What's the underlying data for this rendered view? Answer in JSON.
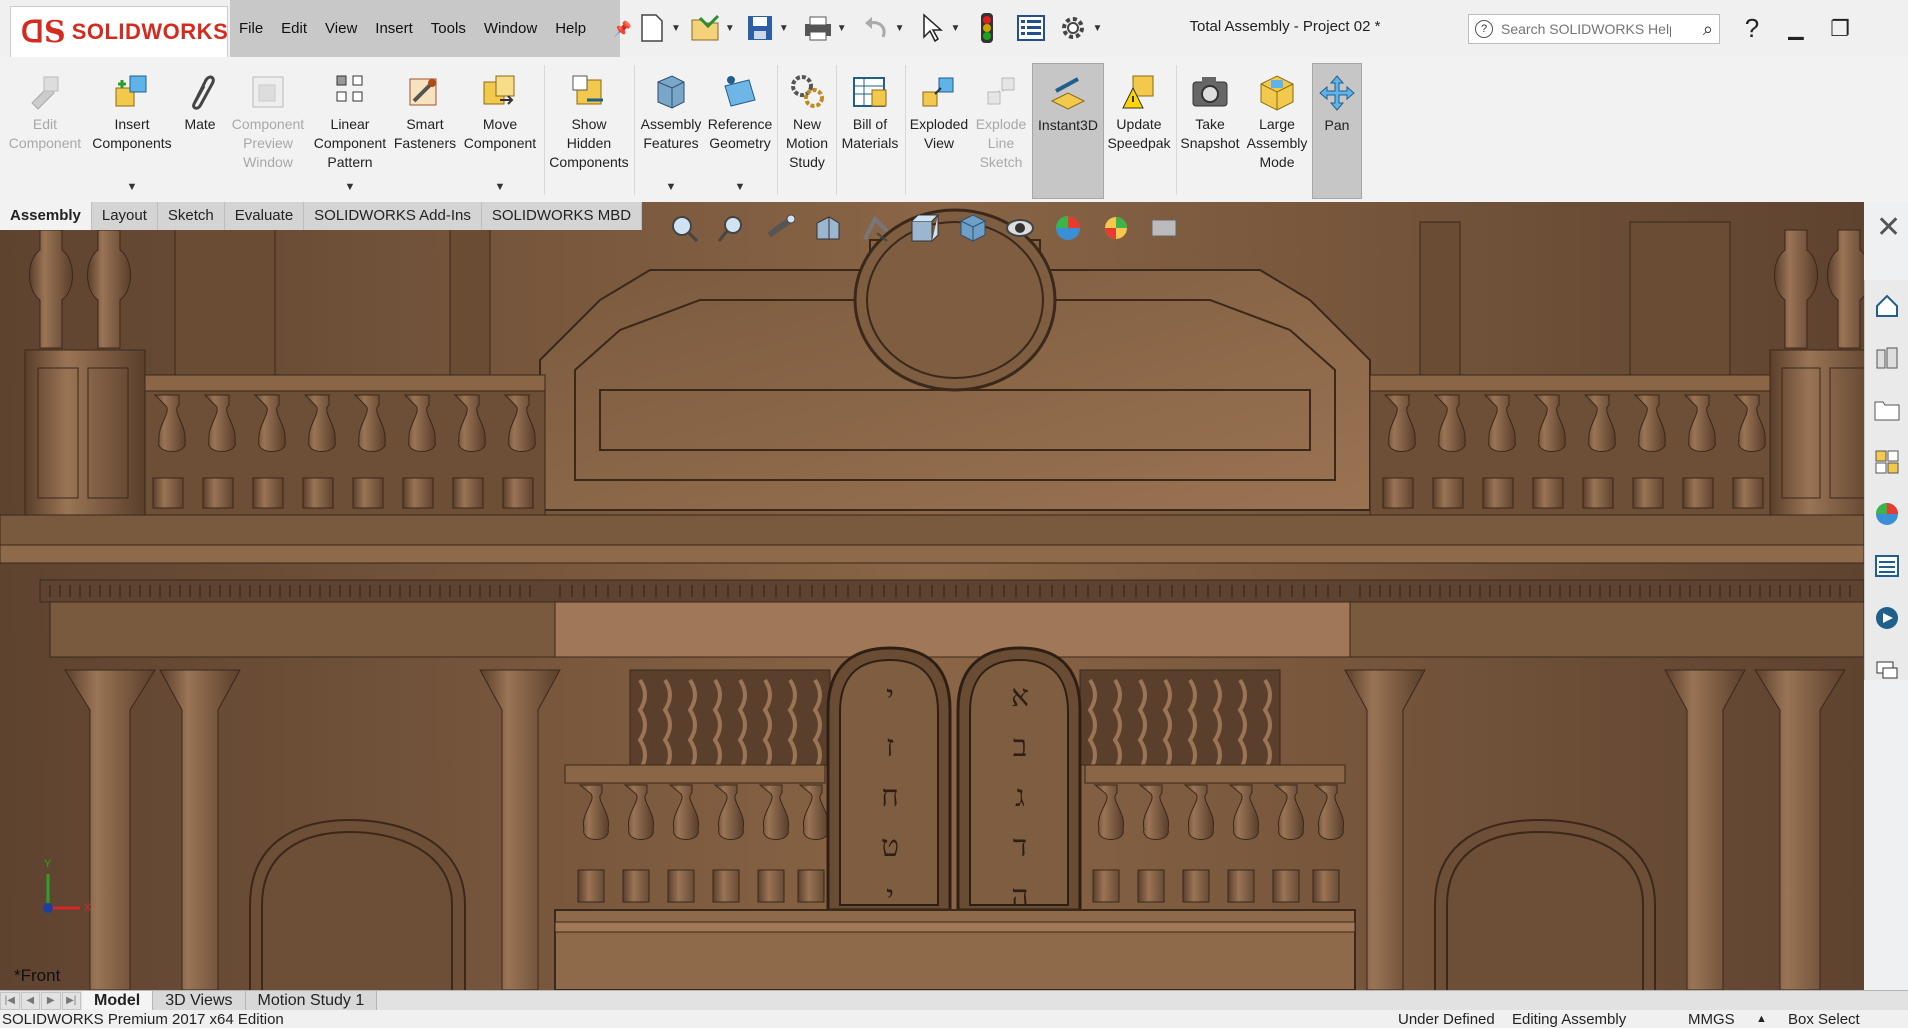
{
  "app": {
    "brand": "SOLIDWORKS",
    "document_title": "Total Assembly - Project 02 *"
  },
  "menu": [
    "File",
    "Edit",
    "View",
    "Insert",
    "Tools",
    "Window",
    "Help"
  ],
  "search": {
    "placeholder": "Search SOLIDWORKS Help"
  },
  "ribbon": {
    "buttons": [
      {
        "label": "Edit\nComponent",
        "icon": "edit-component-icon",
        "enabled": false
      },
      {
        "label": "Insert\nComponents",
        "icon": "insert-components-icon",
        "enabled": true
      },
      {
        "label": "Mate",
        "icon": "mate-icon",
        "enabled": true
      },
      {
        "label": "Component\nPreview\nWindow",
        "icon": "component-preview-icon",
        "enabled": false
      },
      {
        "label": "Linear\nComponent\nPattern",
        "icon": "linear-pattern-icon",
        "enabled": true
      },
      {
        "label": "Smart\nFasteners",
        "icon": "smart-fasteners-icon",
        "enabled": true
      },
      {
        "label": "Move\nComponent",
        "icon": "move-component-icon",
        "enabled": true
      },
      {
        "label": "Show\nHidden\nComponents",
        "icon": "show-hidden-icon",
        "enabled": true
      },
      {
        "label": "Assembly\nFeatures",
        "icon": "assembly-features-icon",
        "enabled": true
      },
      {
        "label": "Reference\nGeometry",
        "icon": "reference-geometry-icon",
        "enabled": true
      },
      {
        "label": "New\nMotion\nStudy",
        "icon": "motion-study-icon",
        "enabled": true
      },
      {
        "label": "Bill of\nMaterials",
        "icon": "bill-of-materials-icon",
        "enabled": true
      },
      {
        "label": "Exploded\nView",
        "icon": "exploded-view-icon",
        "enabled": true
      },
      {
        "label": "Explode\nLine\nSketch",
        "icon": "explode-line-sketch-icon",
        "enabled": false
      },
      {
        "label": "Instant3D",
        "icon": "instant3d-icon",
        "enabled": true,
        "active": true
      },
      {
        "label": "Update\nSpeedpak",
        "icon": "update-speedpak-icon",
        "enabled": true
      },
      {
        "label": "Take\nSnapshot",
        "icon": "camera-icon",
        "enabled": true
      },
      {
        "label": "Large\nAssembly\nMode",
        "icon": "large-assembly-icon",
        "enabled": true
      },
      {
        "label": "Pan",
        "icon": "pan-icon",
        "enabled": true,
        "active": true
      }
    ]
  },
  "tabs": [
    "Assembly",
    "Layout",
    "Sketch",
    "Evaluate",
    "SOLIDWORKS Add-Ins",
    "SOLIDWORKS MBD"
  ],
  "selected_tab": "Assembly",
  "viewport": {
    "view_name": "*Front",
    "triad_y": "Y",
    "triad_x": "X",
    "tablet_letters": [
      "י",
      "ז",
      "ח",
      "ט",
      "י"
    ],
    "tablet_letters_right": [
      "א",
      "ב",
      "ג",
      "ד",
      "ה"
    ]
  },
  "bottom_tabs": [
    "Model",
    "3D Views",
    "Motion Study 1"
  ],
  "status": {
    "edition": "SOLIDWORKS Premium 2017 x64 Edition",
    "state": "Under Defined",
    "mode": "Editing Assembly",
    "units": "MMGS",
    "select": "Box Select"
  },
  "colors": {
    "brand_red": "#d52b1e",
    "wood": "#7a5a3e",
    "wood_dark": "#4d3524",
    "wood_light": "#9b7352"
  }
}
